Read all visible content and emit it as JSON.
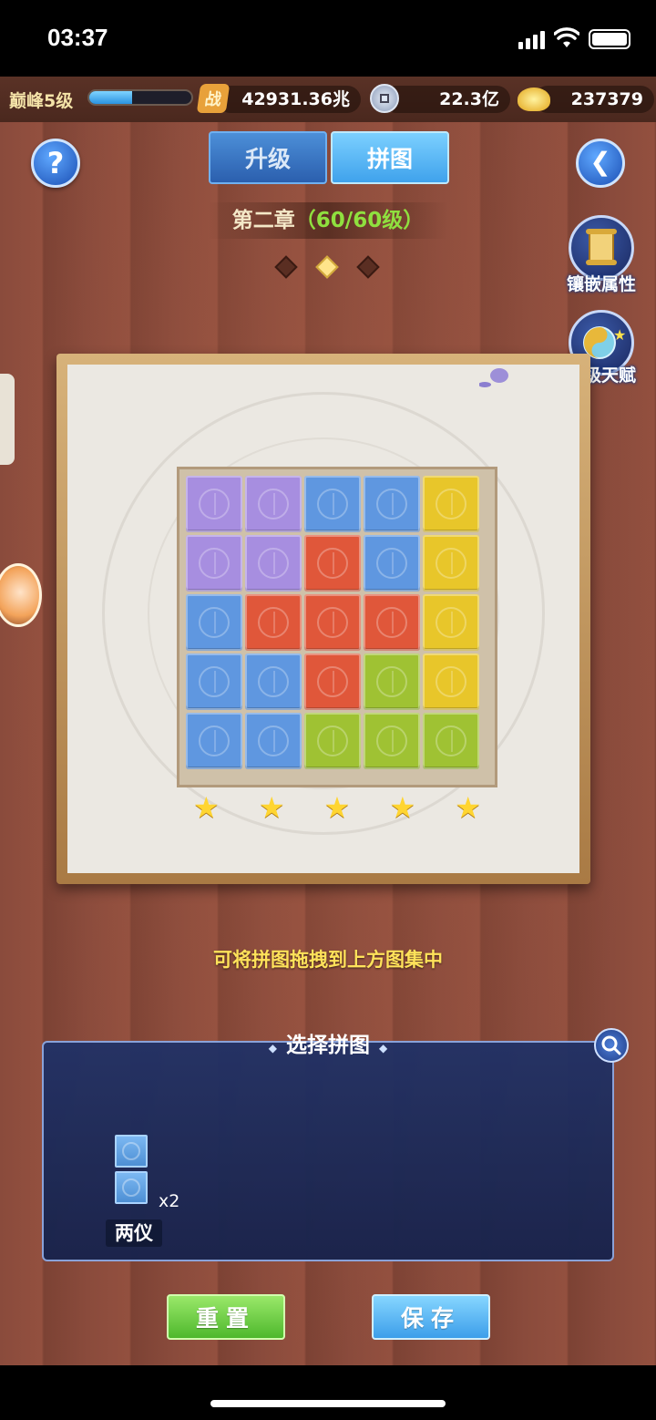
{
  "status_bar": {
    "time": "03:37"
  },
  "resources": {
    "peak_level": "巅峰5级",
    "exp_progress": 0.42,
    "power_icon": "战",
    "power_value": "42931.36兆",
    "coin_value": "22.3亿",
    "gold_value": "237379"
  },
  "tabs": [
    {
      "label": "升级",
      "active": false
    },
    {
      "label": "拼图",
      "active": true
    }
  ],
  "chapter": {
    "name": "第二章",
    "progress": "（60/60级）"
  },
  "page_dots": {
    "count": 3,
    "active": 1
  },
  "side_buttons": [
    {
      "label": "镶嵌属性",
      "icon": "scroll-icon"
    },
    {
      "label": "星级天赋",
      "icon": "taiji-star-icon"
    }
  ],
  "board": {
    "colors": {
      "purple": "#a78ee0",
      "blue": "#5f97e0",
      "red": "#e0573a",
      "yellow": "#e8c62a",
      "green": "#9fc233"
    },
    "grid": [
      [
        "purple",
        "purple",
        "blue",
        "blue",
        "yellow"
      ],
      [
        "purple",
        "purple",
        "red",
        "blue",
        "yellow"
      ],
      [
        "blue",
        "red",
        "red",
        "red",
        "yellow"
      ],
      [
        "blue",
        "blue",
        "red",
        "green",
        "yellow"
      ],
      [
        "blue",
        "blue",
        "green",
        "green",
        "green"
      ]
    ],
    "stars": 5
  },
  "hint": "可将拼图拖拽到上方图集中",
  "panel": {
    "title": "选择拼图",
    "pieces": [
      {
        "name": "两仪",
        "count": "x2",
        "blocks": 2,
        "color": "blue"
      }
    ]
  },
  "buttons": {
    "reset": "重置",
    "save": "保存"
  }
}
